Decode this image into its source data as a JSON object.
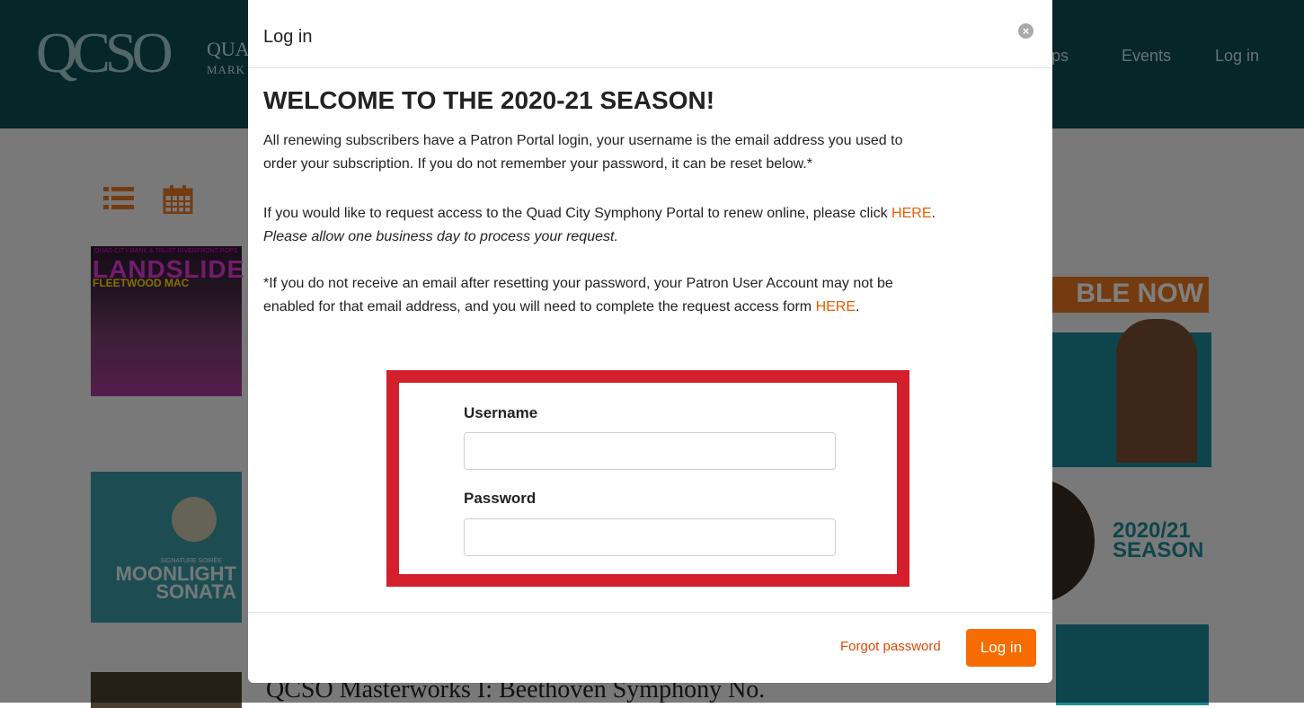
{
  "site": {
    "logo": {
      "mark": "QCSO",
      "line1": "QUA",
      "line2": "MARK"
    },
    "nav": [
      {
        "label": "ips"
      },
      {
        "label": "Events"
      },
      {
        "label": "Log in"
      }
    ],
    "events": [
      {
        "top_line": "QUAD CITY BANK & TRUST RIVERFRONT POPS",
        "title": "LANDSLIDE",
        "subtitle": "FLEETWOOD MAC"
      },
      {
        "top_line": "SIGNATURE SOIRÉE",
        "title": "MOONLIGHT SONATA"
      }
    ],
    "promo": {
      "banner": "BLE NOW",
      "season": "2020/21 SEASON"
    },
    "bg_title": "QCSO Masterworks I: Beethoven Symphony No."
  },
  "modal": {
    "title": "Log in",
    "heading": "WELCOME TO THE 2020-21 SEASON!",
    "p1_line1": "All renewing subscribers have a Patron Portal login, your username is the email address you used to",
    "p1_line2": "order your subscription. If you do not remember your password, it can be reset below.*",
    "p2_prefix": "If you would like to request access to the Quad City Symphony Portal to renew online, please click ",
    "p2_link": "HERE",
    "p2_suffix": ".",
    "p2_italic": "Please allow one business day to process your request.",
    "p3_line1": "*If you do not receive an email after resetting your password,  your Patron User Account may not be",
    "p3_line2_prefix": "enabled for that email address, and you will need to complete the request access form ",
    "p3_link": "HERE",
    "p3_suffix": ".",
    "username_label": "Username",
    "username_value": "",
    "password_label": "Password",
    "password_value": "",
    "forgot_label": "Forgot password",
    "login_label": "Log in"
  },
  "colors": {
    "accent": "#f76c00",
    "header": "#0d4c55",
    "highlight_box": "#d3202c"
  }
}
